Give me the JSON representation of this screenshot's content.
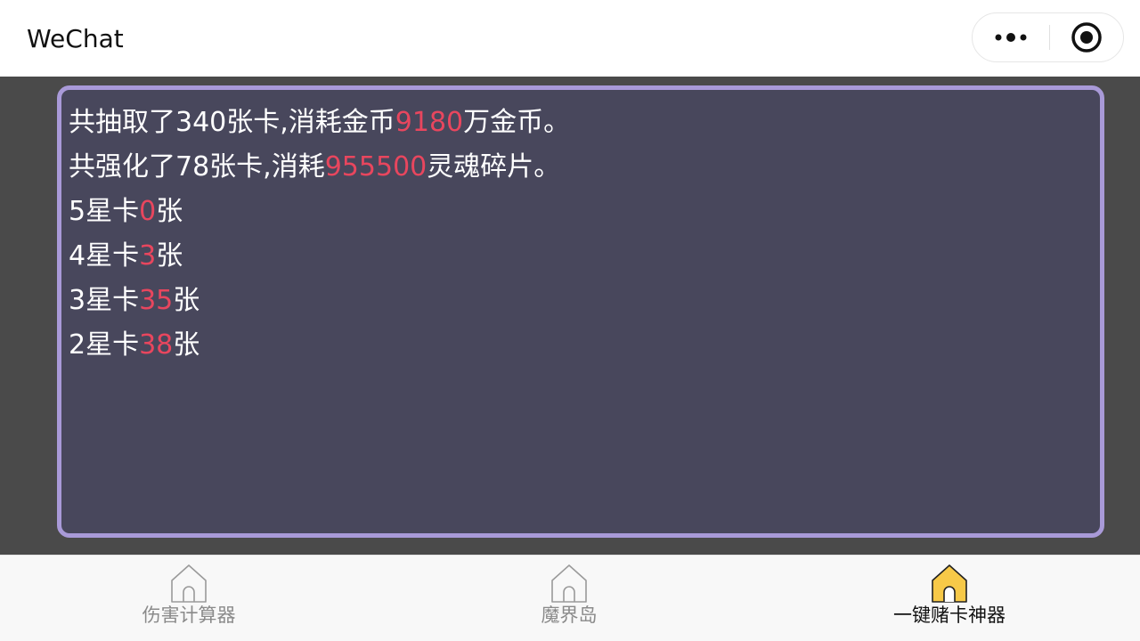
{
  "app": {
    "title": "WeChat"
  },
  "capsule": {
    "more_icon": "more-dots-icon",
    "close_icon": "target-circle-icon"
  },
  "results": {
    "line1": {
      "prefix": "共抽取了340张卡,消耗金币",
      "value": "9180",
      "suffix": "万金币。"
    },
    "line2": {
      "prefix": "共强化了78张卡,消耗",
      "value": "955500",
      "suffix": "灵魂碎片。"
    },
    "line3": {
      "prefix": "5星卡",
      "value": "0",
      "suffix": "张"
    },
    "line4": {
      "prefix": "4星卡",
      "value": "3",
      "suffix": "张"
    },
    "line5": {
      "prefix": "3星卡",
      "value": "35",
      "suffix": "张"
    },
    "line6": {
      "prefix": "2星卡",
      "value": "38",
      "suffix": "张"
    }
  },
  "tabs": [
    {
      "label": "伤害计算器",
      "icon": "home-icon",
      "active": false
    },
    {
      "label": "魔界岛",
      "icon": "home-icon",
      "active": false
    },
    {
      "label": "一键赌卡神器",
      "icon": "home-icon",
      "active": true
    }
  ],
  "colors": {
    "highlight": "#e8465e",
    "panel_border": "#a99ad8",
    "panel_bg": "#48475c",
    "active_icon": "#f7c948"
  }
}
